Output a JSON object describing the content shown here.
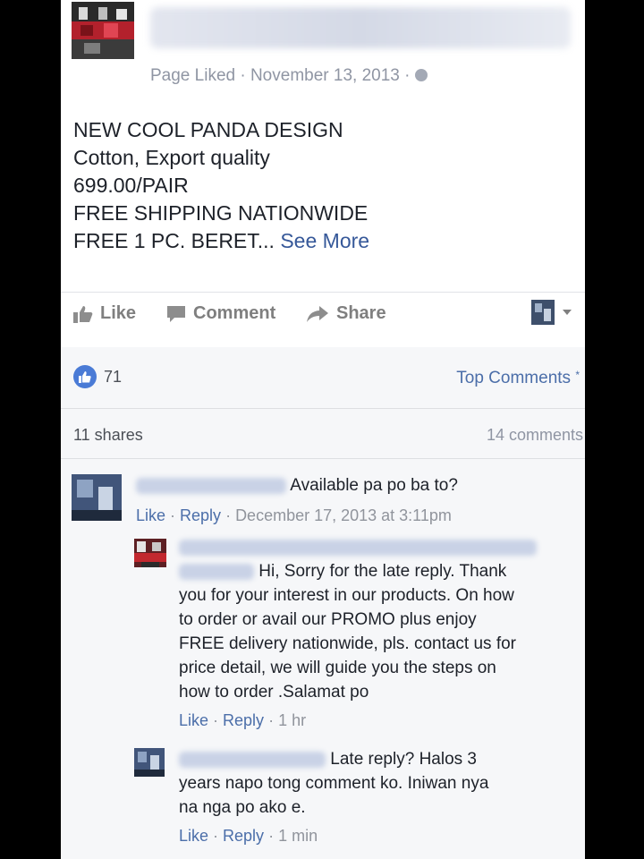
{
  "post": {
    "meta": "Page Liked · November 13, 2013 ·",
    "text_lines": [
      "NEW COOL PANDA DESIGN",
      "Cotton, Export quality",
      "699.00/PAIR",
      "FREE SHIPPING NATIONWIDE",
      "FREE 1 PC. BERET..."
    ],
    "see_more": "See More"
  },
  "actions": {
    "like": "Like",
    "comment": "Comment",
    "share": "Share"
  },
  "stats": {
    "reactions": "71",
    "top_comments": "Top Comments",
    "shares": "11 shares",
    "comments": "14 comments"
  },
  "comments": [
    {
      "text": "Available pa po ba to?",
      "like": "Like",
      "reply": "Reply",
      "time": "December 17, 2013 at 3:11pm"
    },
    {
      "text_first": "Hi, Sorry for the late reply. Thank",
      "text_rest": "you for your interest in our products. On how\nto order or avail our PROMO plus enjoy\nFREE delivery nationwide, pls. contact us for\nprice detail, we will guide you the steps on\nhow to order .Salamat po",
      "like": "Like",
      "reply": "Reply",
      "time": "1 hr"
    },
    {
      "text_first": "Late reply? Halos 3",
      "text_rest": "years napo tong comment ko. Iniwan nya\nna nga po ako e.",
      "like": "Like",
      "reply": "Reply",
      "time": "1 min"
    }
  ],
  "colors": {
    "link": "#365899",
    "like_blue": "#4a7bd6",
    "text": "#1d2129",
    "muted": "#90949c"
  }
}
